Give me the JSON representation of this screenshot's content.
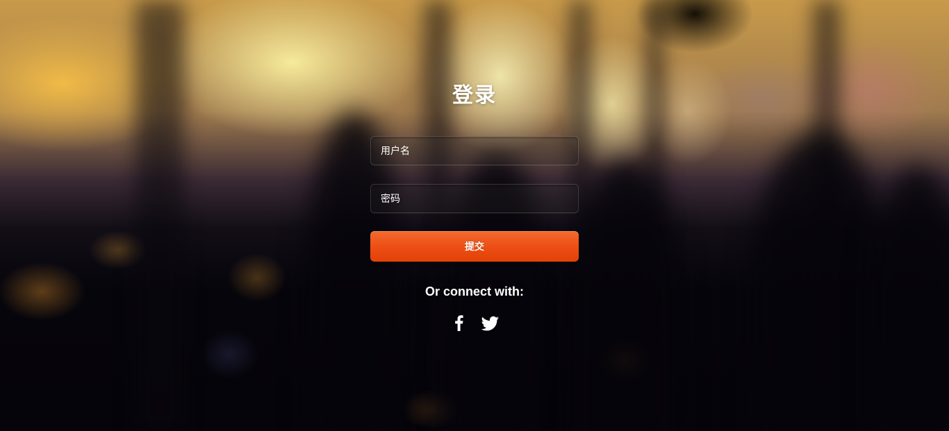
{
  "login": {
    "title": "登录",
    "username_placeholder": "用户名",
    "password_placeholder": "密码",
    "submit_label": "提交",
    "connect_label": "Or connect with:"
  },
  "social": [
    {
      "icon": "facebook-icon"
    },
    {
      "icon": "twitter-icon"
    }
  ],
  "colors": {
    "accent": "#ec4d12",
    "text": "#ffffff"
  }
}
